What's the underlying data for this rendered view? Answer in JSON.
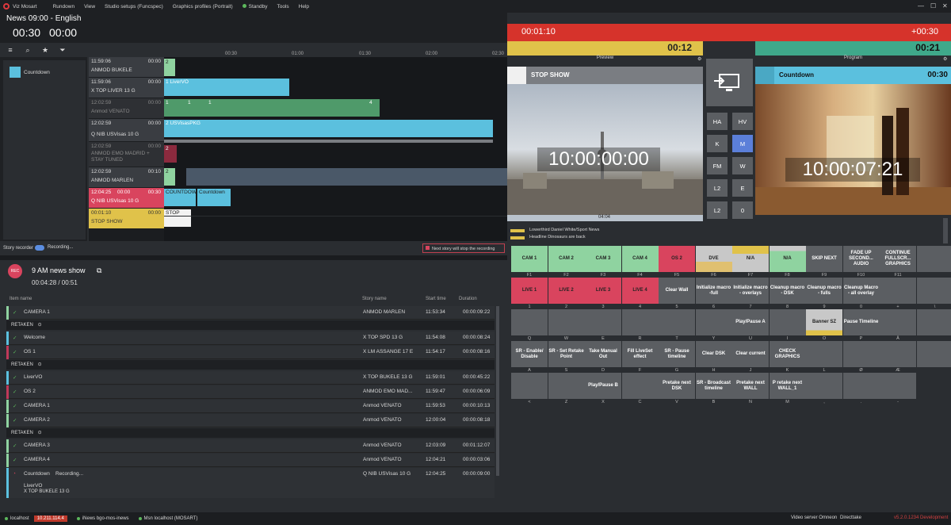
{
  "menu": {
    "app_title": "Viz Mosart",
    "items": [
      "Rundown",
      "View",
      "Studio setups (Funcspec)",
      "Graphics profiles (Portrait)",
      "Standby",
      "Tools",
      "Help"
    ]
  },
  "header": {
    "title": "News 09:00 - English",
    "time_left": "00:30",
    "time_right": "00:00"
  },
  "ruler": [
    "00:30",
    "01:00",
    "01:30",
    "02:00",
    "02:30"
  ],
  "story_panel": {
    "item": "Countdown",
    "color": "#5bc0de"
  },
  "timeline_rows": [
    {
      "time": "11:59:06",
      "dur": "00:00",
      "name": "ANMOD BUKELE",
      "faded": false
    },
    {
      "time": "11:59:06",
      "dur": "00:00",
      "name": "X TOP LIVER 13 G",
      "faded": false
    },
    {
      "time": "12:02:59",
      "dur": "00:00",
      "name": "Anmod VENATO",
      "faded": true
    },
    {
      "time": "12:02:59",
      "dur": "00:00",
      "name": "Q NIB USVisas 10 G",
      "faded": false
    },
    {
      "time": "12:02:59",
      "dur": "00:00",
      "name": "ANMOD EMO MADRID + STAY TUNED",
      "faded": true
    },
    {
      "time": "12:02:59",
      "dur": "00:10",
      "name": "ANMOD MARLEN",
      "faded": false
    },
    {
      "time": "12:04:25",
      "dur": "00:30",
      "name": "Q NIB USVisas 10 G",
      "faded": false,
      "extra": "00:00"
    },
    {
      "time": "00:01:10",
      "dur": "00:00",
      "name": "STOP SHOW",
      "faded": false
    }
  ],
  "timeline_blocks": {
    "b1": "2",
    "b2": "1",
    "b2t": "LiverVO",
    "b3a": "1",
    "b3b": "1",
    "b3c": "4",
    "b4": "2",
    "b4t": "USVisasPKG",
    "b5": "2",
    "b6": "2",
    "b7a": "COUNTDOWN",
    "b7b": "Countdown",
    "b8": "STOP"
  },
  "story_recorder": {
    "label": "Story recorder",
    "recording": "Recording...",
    "warning": "Next story will stop the recording"
  },
  "show": {
    "rec": "REC",
    "name": "9 AM news show",
    "times": "00:04:28 / 00:51"
  },
  "rec_table": {
    "headers": [
      "Item name",
      "Story name",
      "Start time",
      "Duration"
    ],
    "retaken": "RETAKEN",
    "rows": [
      {
        "name": "CAMERA 1",
        "story": "ANMOD MARLEN",
        "start": "11:53:34",
        "dur": "00:00:09:22",
        "color": "#8fd3a0"
      },
      {
        "name": "Welcome",
        "story": "X TOP SPD 13 G",
        "start": "11:54:08",
        "dur": "00:00:08:24",
        "color": "#5bc0de"
      },
      {
        "name": "OS 1",
        "story": "X LM ASSANGE 17 E",
        "start": "11:54:17",
        "dur": "00:00:08:16",
        "color": "#c0395a"
      },
      {
        "name": "LiverVO",
        "story": "X TOP BUKELE 13 G",
        "start": "11:59:01",
        "dur": "00:00:45:22",
        "color": "#5bc0de"
      },
      {
        "name": "OS 2",
        "story": "ANMOD EMO MAD...",
        "start": "11:59:47",
        "dur": "00:00:06:09",
        "color": "#c0395a"
      },
      {
        "name": "CAMERA 1",
        "story": "Anmod VENATO",
        "start": "11:59:53",
        "dur": "00:00:10:13",
        "color": "#8fd3a0"
      },
      {
        "name": "CAMERA 2",
        "story": "Anmod VENATO",
        "start": "12:00:04",
        "dur": "00:00:08:18",
        "color": "#8fd3a0"
      },
      {
        "name": "CAMERA 3",
        "story": "Anmod VENATO",
        "start": "12:03:09",
        "dur": "00:01:12:07",
        "color": "#8fd3a0"
      },
      {
        "name": "CAMERA 4",
        "story": "Anmod VENATO",
        "start": "12:04:21",
        "dur": "00:00:03:06",
        "color": "#8fd3a0"
      },
      {
        "name": "Countdown",
        "story": "Q NIB USVisas 10 G",
        "start": "12:04:25",
        "dur": "00:00:09:00",
        "color": "#5bc0de",
        "status": "Recording..."
      }
    ],
    "bottom_item": "LiverVO",
    "bottom_story": "X TOP BUKELE 13 G"
  },
  "timers": {
    "left": "00:01:10",
    "right": "+00:30",
    "yellow": "00:12",
    "green": "00:21"
  },
  "preview": {
    "label": "Preview",
    "title": "STOP SHOW",
    "timecode": "10:00:00:00",
    "scrub": "04:04",
    "lower1": "Lowerthird Daniel White/Sport News",
    "lower2": "Headline Dinosaurs are back"
  },
  "program": {
    "label": "Program",
    "title": "Countdown",
    "time": "00:30",
    "timecode": "10:00:07:21"
  },
  "side_buttons": [
    "HA",
    "HV",
    "K",
    "M",
    "FM",
    "W",
    "L2",
    "E",
    "L2",
    "0"
  ],
  "grid": [
    [
      {
        "t": "CAM 1",
        "k": "F1",
        "c": "#8fd3a0"
      },
      {
        "t": "CAM 2",
        "k": "F2",
        "c": "#8fd3a0"
      },
      {
        "t": "CAM 3",
        "k": "F3",
        "c": "#8fd3a0"
      },
      {
        "t": "CAM 4",
        "k": "F4",
        "c": "#8fd3a0"
      },
      {
        "t": "OS 2",
        "k": "F5",
        "c": "#d9445e"
      },
      {
        "t": "DVE",
        "k": "F6",
        "c": "#e0c070"
      },
      {
        "t": "N/A",
        "k": "F7",
        "c": "#c0c0c0"
      },
      {
        "t": "N/A",
        "k": "F8",
        "c": "#8fd3a0"
      },
      {
        "t": "SKIP NEXT",
        "k": "F9",
        "c": ""
      },
      {
        "t": "FADE UP SECOND... AUDIO",
        "k": "F10",
        "c": ""
      },
      {
        "t": "CONTINUE FULLSCR... GRAPHICS",
        "k": "F11",
        "c": ""
      },
      {
        "t": "",
        "k": "",
        "c": ""
      }
    ],
    [
      {
        "t": "LIVE 1",
        "k": "1",
        "c": "#d9445e"
      },
      {
        "t": "LIVE 2",
        "k": "2",
        "c": "#d9445e"
      },
      {
        "t": "LIVE 3",
        "k": "3",
        "c": "#d9445e"
      },
      {
        "t": "LIVE 4",
        "k": "4",
        "c": "#d9445e"
      },
      {
        "t": "Clear Wall",
        "k": "5",
        "c": ""
      },
      {
        "t": "Initialize macro -full",
        "k": "6",
        "c": ""
      },
      {
        "t": "Initialize macro - overlays",
        "k": "7",
        "c": ""
      },
      {
        "t": "Cleanup macro - DSK",
        "k": "8",
        "c": ""
      },
      {
        "t": "Cleanup macro - fulls",
        "k": "9",
        "c": ""
      },
      {
        "t": "Cleanup Macro - all overlay",
        "k": "0",
        "c": ""
      },
      {
        "t": "",
        "k": "+",
        "c": ""
      },
      {
        "t": "",
        "k": "\\",
        "c": ""
      }
    ],
    [
      {
        "t": "",
        "k": "Q",
        "c": ""
      },
      {
        "t": "",
        "k": "W",
        "c": ""
      },
      {
        "t": "",
        "k": "E",
        "c": ""
      },
      {
        "t": "",
        "k": "R",
        "c": ""
      },
      {
        "t": "",
        "k": "T",
        "c": ""
      },
      {
        "t": "",
        "k": "Y",
        "c": ""
      },
      {
        "t": "Play/Pause A",
        "k": "U",
        "c": ""
      },
      {
        "t": "",
        "k": "I",
        "c": ""
      },
      {
        "t": "Banner SZ",
        "k": "O",
        "c": "#c8c8c8"
      },
      {
        "t": "Pause Timeline",
        "k": "P",
        "c": ""
      },
      {
        "t": "",
        "k": "Å",
        "c": ""
      },
      {
        "t": "",
        "k": "",
        "c": ""
      }
    ],
    [
      {
        "t": "SR - Enable/ Disable",
        "k": "A",
        "c": ""
      },
      {
        "t": "SR - Set Retake Point",
        "k": "S",
        "c": ""
      },
      {
        "t": "Take Manual Out",
        "k": "D",
        "c": ""
      },
      {
        "t": "Fill LiveSet effect",
        "k": "F",
        "c": ""
      },
      {
        "t": "SR - Pause timeline",
        "k": "G",
        "c": ""
      },
      {
        "t": "Clear DSK",
        "k": "H",
        "c": ""
      },
      {
        "t": "Clear current",
        "k": "J",
        "c": ""
      },
      {
        "t": "CHECK GRAPHICS",
        "k": "K",
        "c": ""
      },
      {
        "t": "",
        "k": "L",
        "c": ""
      },
      {
        "t": "",
        "k": "Ø",
        "c": ""
      },
      {
        "t": "",
        "k": "Æ",
        "c": ""
      },
      {
        "t": "",
        "k": "",
        "c": ""
      }
    ],
    [
      {
        "t": "",
        "k": "<",
        "c": ""
      },
      {
        "t": "",
        "k": "Z",
        "c": ""
      },
      {
        "t": "Play/Pause B",
        "k": "X",
        "c": ""
      },
      {
        "t": "",
        "k": "C",
        "c": ""
      },
      {
        "t": "Pretake next DSK",
        "k": "V",
        "c": ""
      },
      {
        "t": "SR - Broadcast timeline",
        "k": "B",
        "c": ""
      },
      {
        "t": "Pretake next WALL",
        "k": "N",
        "c": ""
      },
      {
        "t": "P retake next WALL_1",
        "k": "M",
        "c": ""
      },
      {
        "t": "",
        "k": ",",
        "c": ""
      },
      {
        "t": "",
        "k": ".",
        "c": ""
      },
      {
        "t": "",
        "k": "-",
        "c": ""
      }
    ]
  ],
  "status": {
    "host": "localhost",
    "ip": "10.211.114.4",
    "inews": "iNews bgo-mos-inews",
    "msn": "Msn localhost (MOSART)",
    "video": "Video server Omneon",
    "direct": "Directtake",
    "version": "v5.2.0.1234 Development"
  }
}
